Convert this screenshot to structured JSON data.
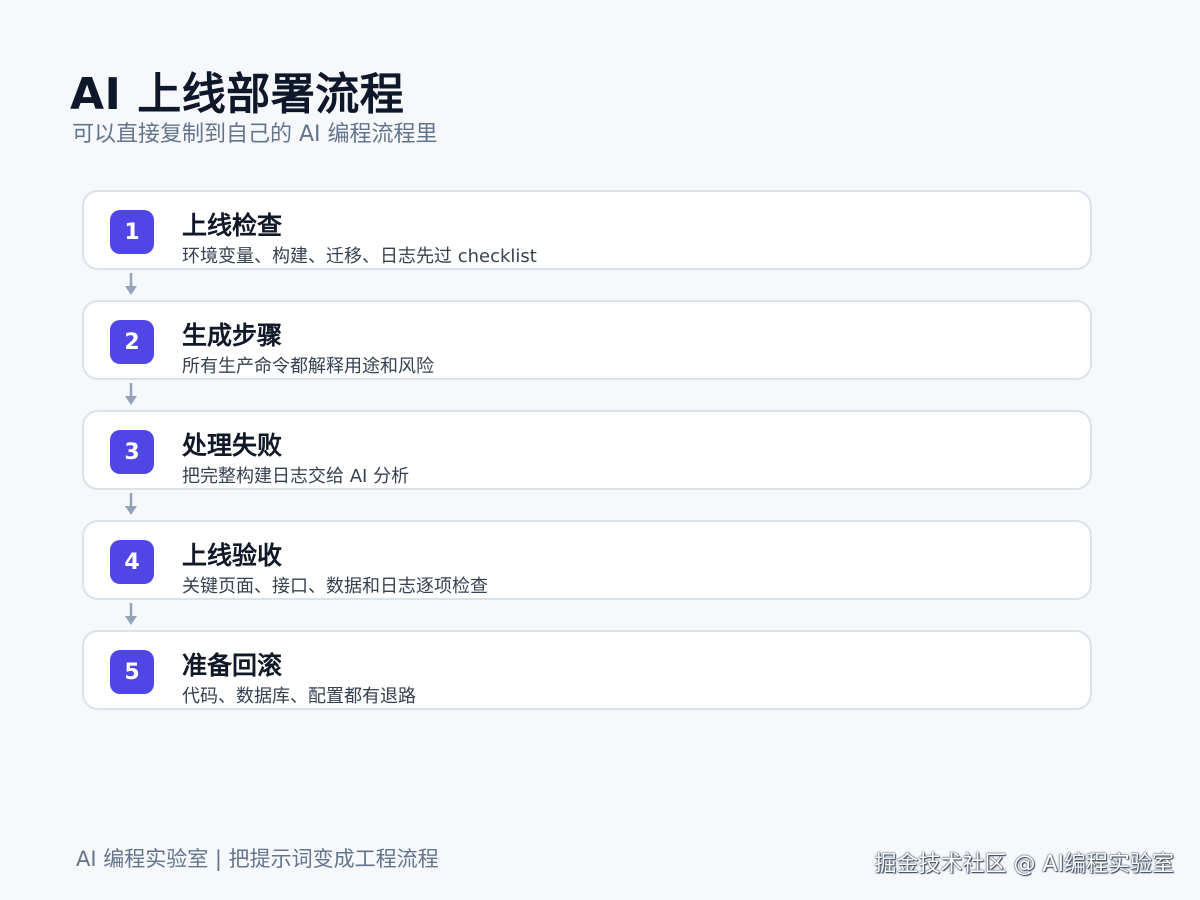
{
  "header": {
    "title": "AI 上线部署流程",
    "subtitle": "可以直接复制到自己的 AI 编程流程里"
  },
  "steps": [
    {
      "number": "1",
      "title": "上线检查",
      "description": "环境变量、构建、迁移、日志先过 checklist"
    },
    {
      "number": "2",
      "title": "生成步骤",
      "description": "所有生产命令都解释用途和风险"
    },
    {
      "number": "3",
      "title": "处理失败",
      "description": "把完整构建日志交给 AI 分析"
    },
    {
      "number": "4",
      "title": "上线验收",
      "description": "关键页面、接口、数据和日志逐项检查"
    },
    {
      "number": "5",
      "title": "准备回滚",
      "description": "代码、数据库、配置都有退路"
    }
  ],
  "footer": {
    "left": "AI 编程实验室 | 把提示词变成工程流程",
    "watermark": "掘金技术社区 @ AI编程实验室"
  },
  "colors": {
    "accent": "#4f46e5",
    "connector": "#94a3b8",
    "card_border": "#dbe2ea",
    "background": "#f6f8fc"
  },
  "icons": {
    "connector": "arrow-down-icon"
  }
}
